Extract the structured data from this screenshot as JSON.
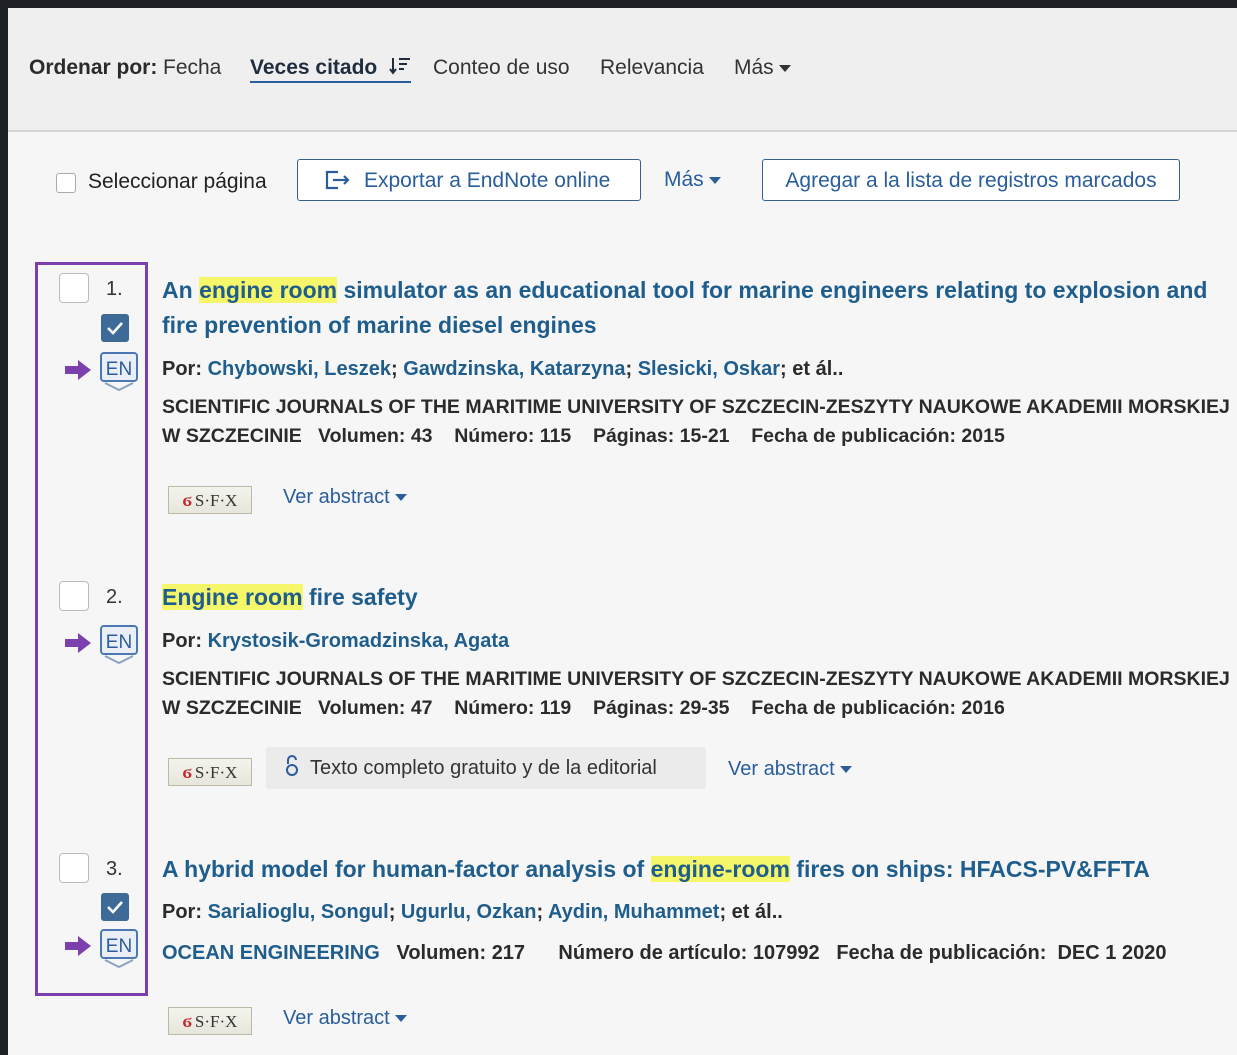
{
  "sort": {
    "label": "Ordenar por:",
    "options": [
      "Fecha",
      "Veces citado",
      "Conteo de uso",
      "Relevancia",
      "Más"
    ],
    "active": "Veces citado"
  },
  "toolbar": {
    "select_page": "Seleccionar página",
    "export": "Exportar a EndNote online",
    "more": "Más",
    "add_marked": "Agregar a la lista de registros marcados"
  },
  "records": [
    {
      "number": "1.",
      "title_pre": "An ",
      "title_hl": "engine room",
      "title_post": " simulator as an educational tool for marine engineers relating to explosion and fire prevention of marine diesel engines",
      "by": "Por:",
      "authors": [
        "Chybowski, Leszek",
        "Gawdzinska, Katarzyna",
        "Slesicki, Oskar"
      ],
      "etal": "; et ál..",
      "journal": "SCIENTIFIC JOURNALS OF THE MARITIME UNIVERSITY OF SZCZECIN-ZESZYTY NAUKOWE AKADEMII MORSKIEJ W SZCZECINIE",
      "volume_label": "Volumen:",
      "volume": "43",
      "issue_label": "Número:",
      "issue": "115",
      "pages_label": "Páginas:",
      "pages": "15-21",
      "date_label": "Fecha de publicación:",
      "date": "2015",
      "abstract": "Ver abstract",
      "marked": true
    },
    {
      "number": "2.",
      "title_pre": "",
      "title_hl": "Engine room",
      "title_post": " fire safety",
      "by": "Por:",
      "authors": [
        "Krystosik-Gromadzinska, Agata"
      ],
      "etal": "",
      "journal": "SCIENTIFIC JOURNALS OF THE MARITIME UNIVERSITY OF SZCZECIN-ZESZYTY NAUKOWE AKADEMII MORSKIEJ W SZCZECINIE",
      "volume_label": "Volumen:",
      "volume": "47",
      "issue_label": "Número:",
      "issue": "119",
      "pages_label": "Páginas:",
      "pages": "29-35",
      "date_label": "Fecha de publicación:",
      "date": "2016",
      "free_text": "Texto completo gratuito y de la editorial",
      "abstract": "Ver abstract",
      "marked": false
    },
    {
      "number": "3.",
      "title_pre": "A hybrid model for human-factor analysis of ",
      "title_hl": "engine-room",
      "title_post": " fires on ships: HFACS-PV&FFTA",
      "by": "Por:",
      "authors": [
        "Sarialioglu, Songul",
        "Ugurlu, Ozkan",
        "Aydin, Muhammet"
      ],
      "etal": "; et ál..",
      "journal": "OCEAN ENGINEERING",
      "volume_label": "Volumen:",
      "volume": "217",
      "article_label": "Número de artículo:",
      "article": "107992",
      "date_label": "Fecha de publicación:",
      "date": "DEC 1 2020",
      "abstract": "Ver abstract",
      "marked": true
    }
  ],
  "icons": {
    "endnote": "EN",
    "sfx": "S·F·X",
    "arrow_color": "#7b3fae",
    "highlight_color": "#f6f66a",
    "link_color": "#1f5d8c"
  }
}
